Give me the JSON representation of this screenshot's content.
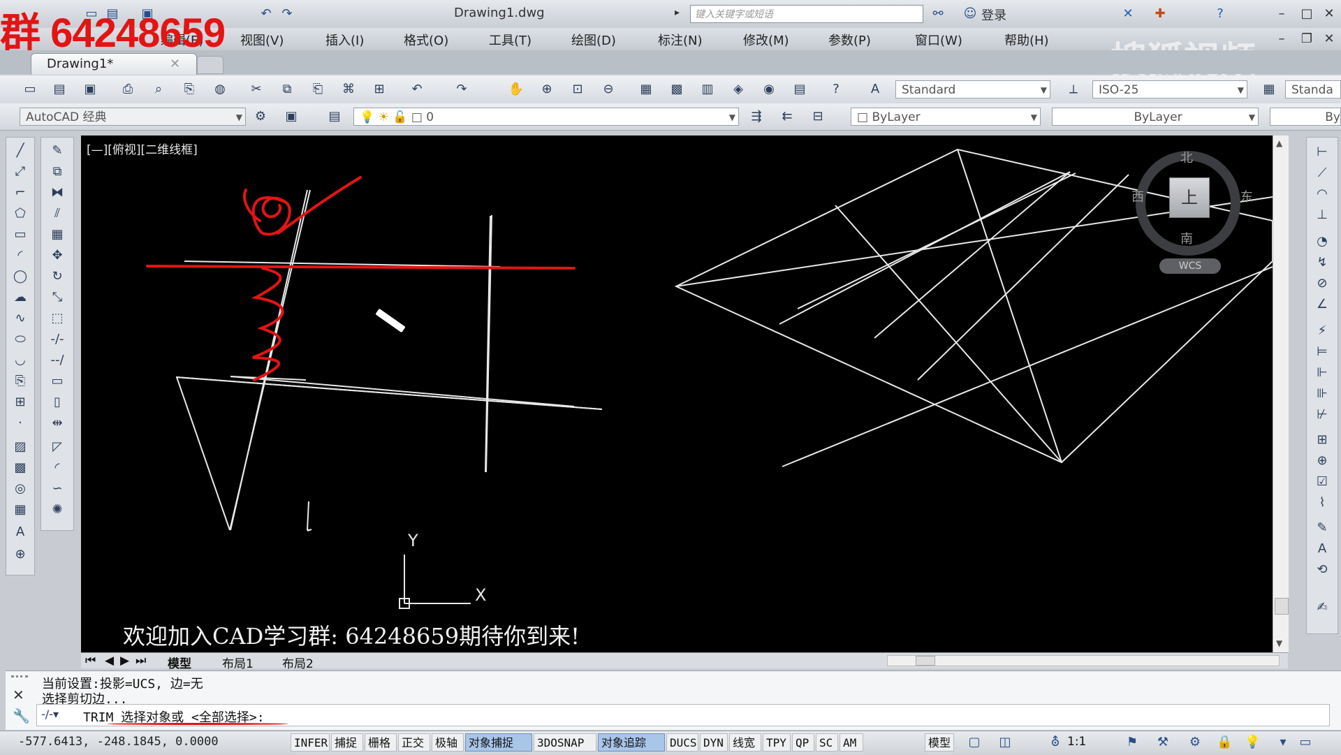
{
  "window": {
    "title": "Drawing1.dwg",
    "search_placeholder": "键入关键字或短语",
    "login": "登录"
  },
  "watermarks": {
    "qq_group": "群 64248659",
    "sohu": "搜狐视频"
  },
  "menu": [
    "编辑(E)",
    "视图(V)",
    "插入(I)",
    "格式(O)",
    "工具(T)",
    "绘图(D)",
    "标注(N)",
    "修改(M)",
    "参数(P)",
    "窗口(W)",
    "帮助(H)"
  ],
  "tabs": {
    "active": "Drawing1*"
  },
  "toolbar": {
    "text_style": "Standard",
    "dim_style": "ISO-25",
    "table_style": "Standa",
    "workspace": "AutoCAD 经典",
    "layer": "0",
    "color": "ByLayer",
    "linetype": "ByLayer",
    "lineweight": "By"
  },
  "viewport": {
    "label": "[—][俯视][二维线框]",
    "welcome_text": "欢迎加入CAD学习群:  64248659期待你到来!",
    "ucs": {
      "y": "Y",
      "x": "X"
    }
  },
  "navcube": {
    "north": "北",
    "south": "南",
    "east": "东",
    "west": "西",
    "face": "上",
    "wcs": "WCS"
  },
  "layout_tabs": [
    "模型",
    "布局1",
    "布局2"
  ],
  "command": {
    "history": [
      "当前设置:投影=UCS, 边=无",
      "选择剪切边..."
    ],
    "prompt": "TRIM 选择对象或 <全部选择>:"
  },
  "status": {
    "coords": "-577.6413,  -248.1845, 0.0000",
    "buttons": [
      {
        "label": "INFER",
        "on": false
      },
      {
        "label": "捕捉",
        "on": false
      },
      {
        "label": "栅格",
        "on": false
      },
      {
        "label": "正交",
        "on": false
      },
      {
        "label": "极轴",
        "on": false
      },
      {
        "label": "对象捕捉",
        "on": true
      },
      {
        "label": "3DOSNAP",
        "on": false
      },
      {
        "label": "对象追踪",
        "on": true
      },
      {
        "label": "DUCS",
        "on": false
      },
      {
        "label": "DYN",
        "on": false
      },
      {
        "label": "线宽",
        "on": false
      },
      {
        "label": "TPY",
        "on": false
      },
      {
        "label": "QP",
        "on": false
      },
      {
        "label": "SC",
        "on": false
      },
      {
        "label": "AM",
        "on": false
      }
    ],
    "model_label": "模型",
    "annotation_scale": "1:1"
  },
  "colors": {
    "viewport_bg": "#000000",
    "annotation_red": "#e31414",
    "status_on": "#a9c6e9"
  }
}
